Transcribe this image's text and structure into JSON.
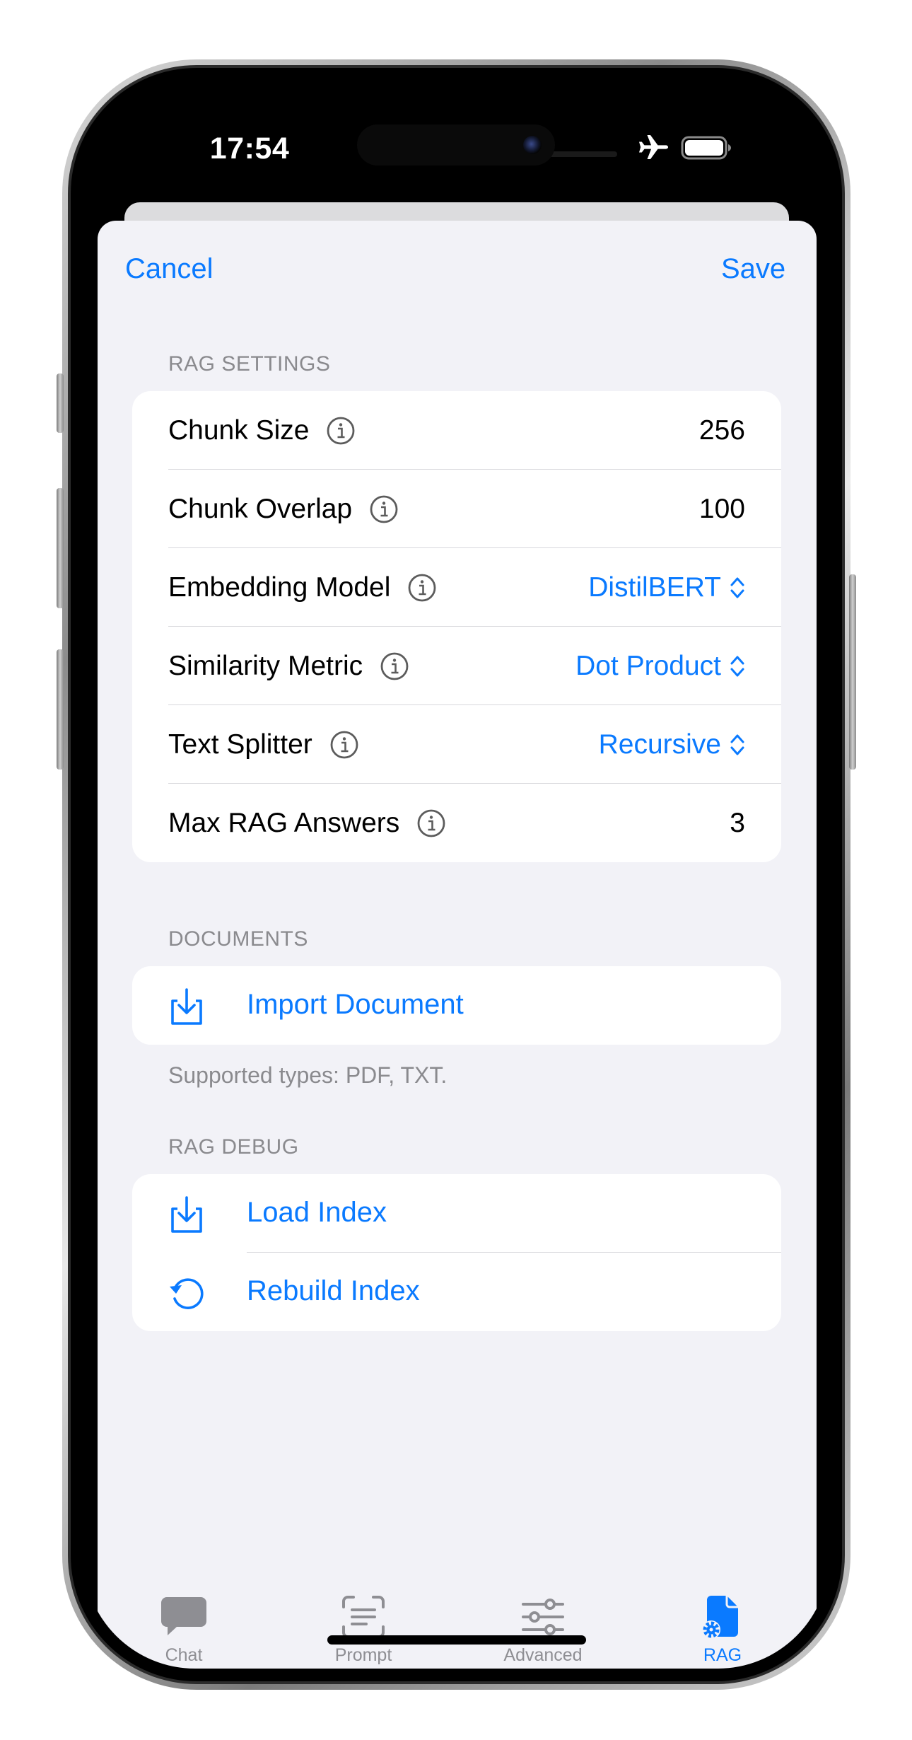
{
  "status_bar": {
    "time": "17:54"
  },
  "nav": {
    "cancel_label": "Cancel",
    "save_label": "Save"
  },
  "rag_settings": {
    "header": "RAG SETTINGS",
    "rows": [
      {
        "label": "Chunk Size",
        "value": "256",
        "kind": "value"
      },
      {
        "label": "Chunk Overlap",
        "value": "100",
        "kind": "value"
      },
      {
        "label": "Embedding Model",
        "value": "DistilBERT",
        "kind": "picker"
      },
      {
        "label": "Similarity Metric",
        "value": "Dot Product",
        "kind": "picker"
      },
      {
        "label": "Text Splitter",
        "value": "Recursive",
        "kind": "picker"
      },
      {
        "label": "Max RAG Answers",
        "value": "3",
        "kind": "value"
      }
    ]
  },
  "documents": {
    "header": "DOCUMENTS",
    "import_label": "Import Document",
    "footer": "Supported types: PDF, TXT."
  },
  "rag_debug": {
    "header": "RAG DEBUG",
    "load_label": "Load Index",
    "rebuild_label": "Rebuild Index"
  },
  "tabs": [
    {
      "label": "Chat",
      "icon": "chat-bubble-icon",
      "active": false
    },
    {
      "label": "Prompt",
      "icon": "prompt-scan-icon",
      "active": false
    },
    {
      "label": "Advanced",
      "icon": "sliders-icon",
      "active": false
    },
    {
      "label": "RAG",
      "icon": "document-gear-icon",
      "active": true
    }
  ],
  "colors": {
    "accent": "#0a7aff",
    "background": "#f2f2f7",
    "secondary_text": "#8a8a8e",
    "inactive_tab": "#8e8e93"
  }
}
